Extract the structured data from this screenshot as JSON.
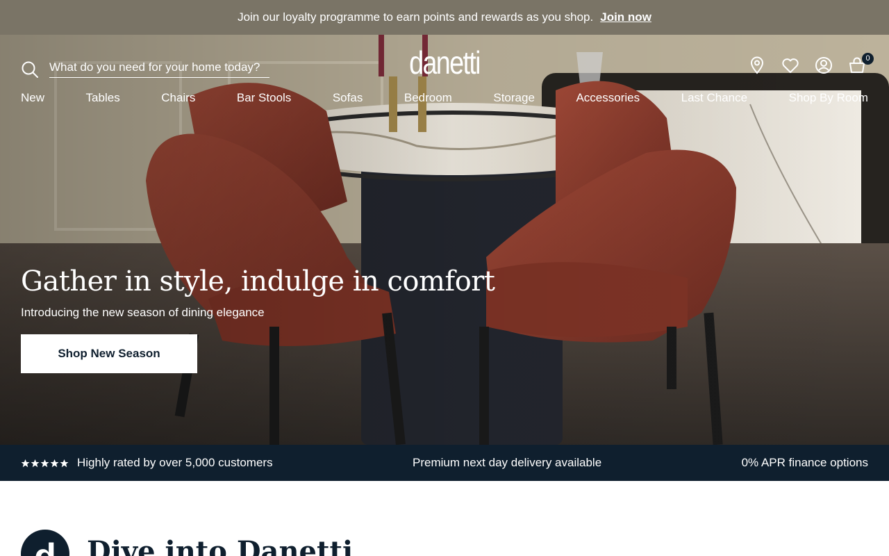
{
  "announcement": {
    "text": "Join our loyalty programme to earn points and rewards as you shop.",
    "link": "Join now"
  },
  "header": {
    "logo": "danetti",
    "search_placeholder": "What do you need for your home today?",
    "icons": [
      "search-icon",
      "location-pin-icon",
      "heart-icon",
      "account-icon",
      "basket-icon"
    ],
    "cart_count": "0"
  },
  "nav": {
    "items": [
      "New",
      "Tables",
      "Chairs",
      "Bar Stools",
      "Sofas",
      "Bedroom",
      "Storage",
      "Accessories",
      "Last Chance",
      "Shop By Room"
    ]
  },
  "hero": {
    "title": "Gather in style, indulge in comfort",
    "subtitle": "Introducing the new season of dining elegance",
    "cta": "Shop New Season"
  },
  "usp": {
    "rating_stars": 5,
    "rated": "Highly rated by over 5,000 customers",
    "delivery": "Premium next day delivery available",
    "finance": "0% APR finance options"
  },
  "dive": {
    "badge": "d",
    "title": "Dive into Danetti"
  },
  "colors": {
    "announcement_bg": "#7a7466",
    "navy": "#0f1f2e",
    "velvet": "#8a3a2c",
    "white": "#ffffff"
  }
}
